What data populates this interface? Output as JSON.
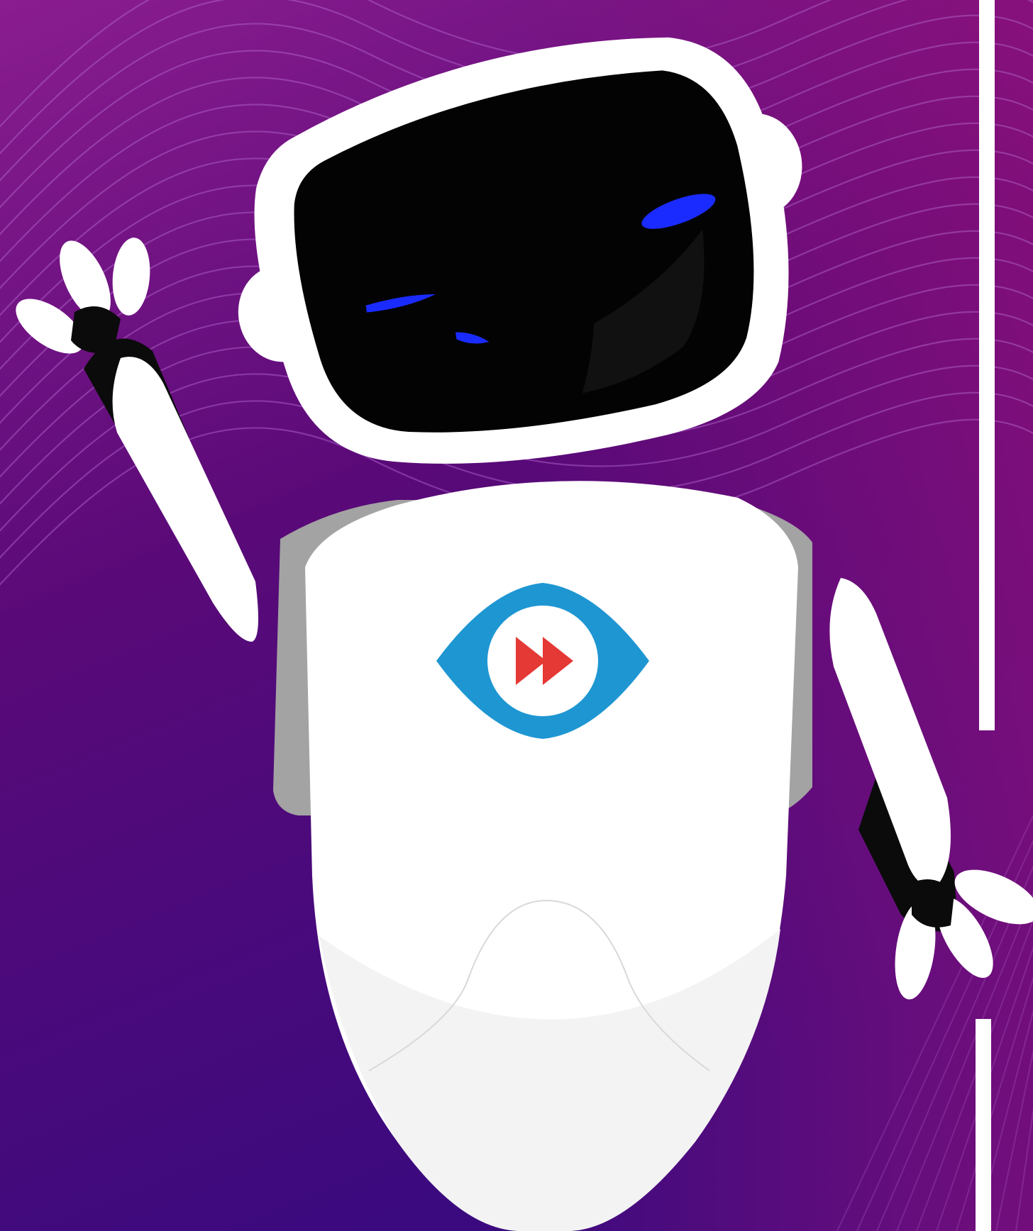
{
  "scene": {
    "background_top_color": "#8a1d8f",
    "background_mid_color": "#5a0a78",
    "background_bottom_color": "#3b0a7e",
    "wave_line_color": "#b56bd0",
    "divider_color": "#ffffff"
  },
  "robot": {
    "shell_color": "#ffffff",
    "shade_color": "#f3f3f3",
    "side_panel_color": "#a3a3a3",
    "visor_color": "#030303",
    "eye_glow_color": "#1a2bff",
    "joint_color": "#0b0b0b"
  },
  "emblem": {
    "ring_color": "#1e96d2",
    "inner_color": "#ffffff",
    "icon_color": "#e53935",
    "icon": "fast-forward-icon"
  }
}
